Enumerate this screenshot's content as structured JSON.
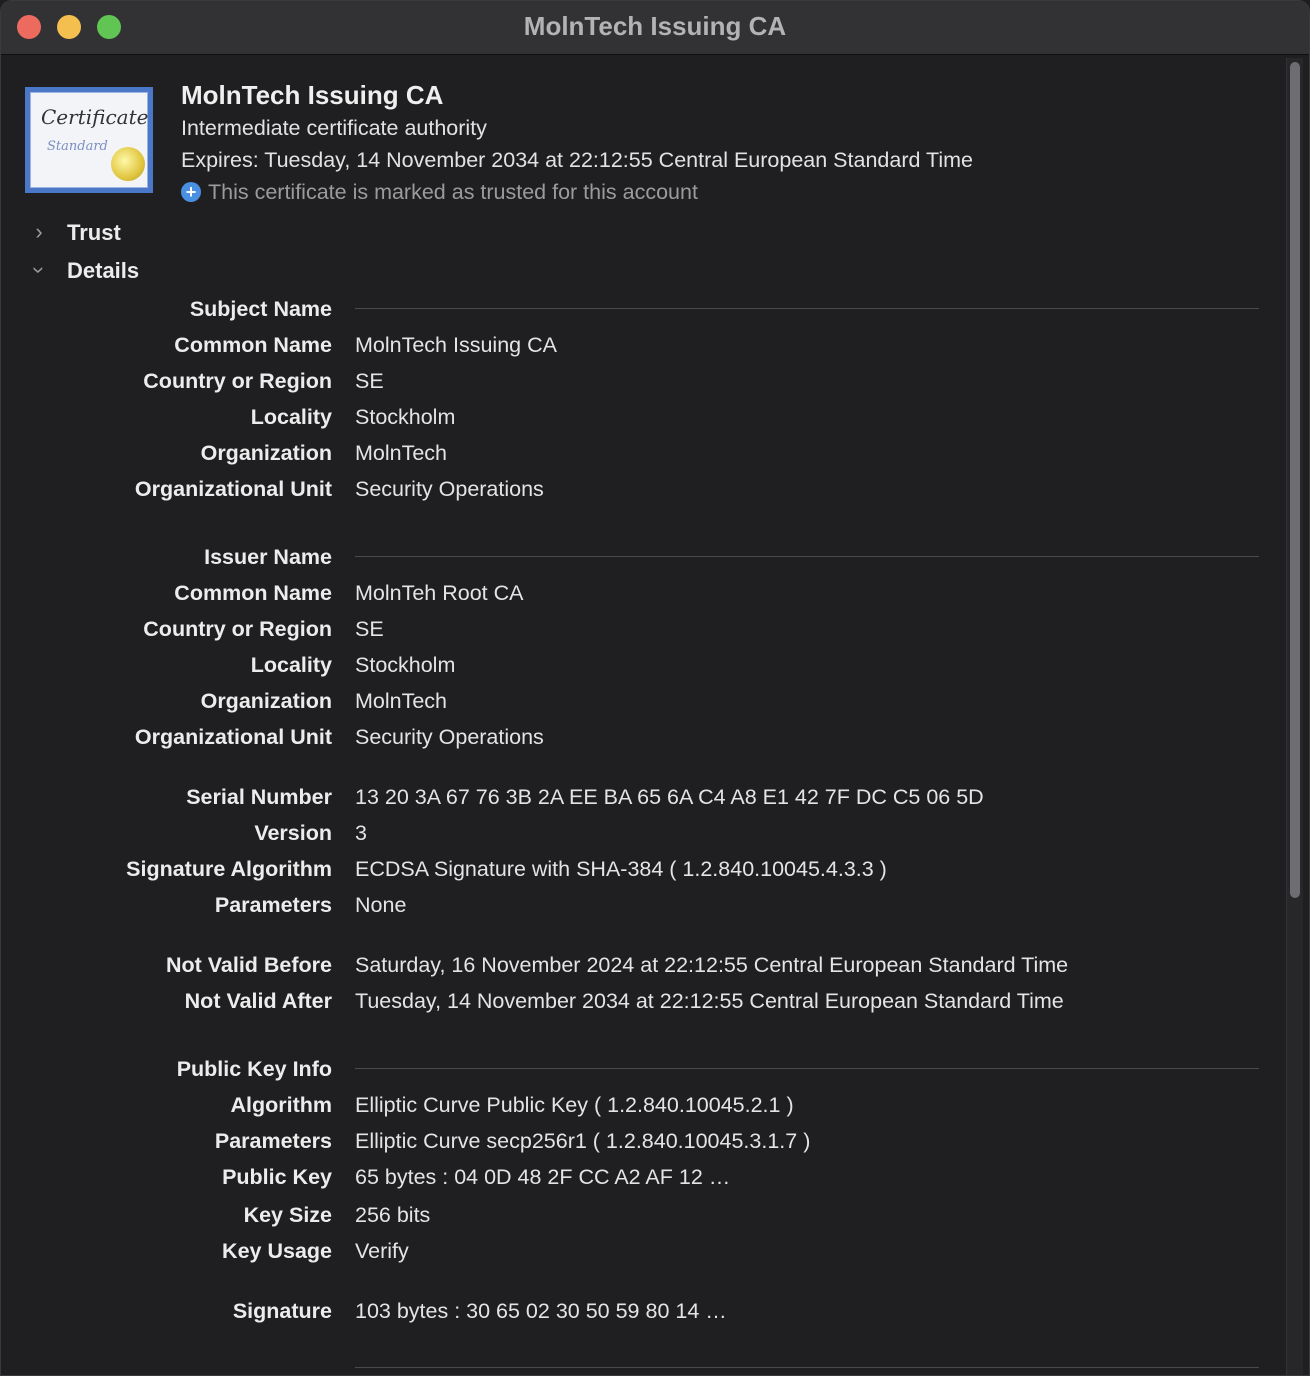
{
  "window": {
    "title": "MolnTech Issuing CA"
  },
  "cert_icon": {
    "script_top": "Certificate",
    "script_bottom": "Standard"
  },
  "header": {
    "name": "MolnTech Issuing CA",
    "kind": "Intermediate certificate authority",
    "expires": "Expires: Tuesday, 14 November 2034 at 22:12:55 Central European Standard Time",
    "trust_status": "This certificate is marked as trusted for this account"
  },
  "sections": {
    "trust": "Trust",
    "details": "Details"
  },
  "details": {
    "subject": {
      "heading": "Subject Name",
      "rows": [
        {
          "label": "Common Name",
          "value": "MolnTech Issuing CA"
        },
        {
          "label": "Country or Region",
          "value": "SE"
        },
        {
          "label": "Locality",
          "value": "Stockholm"
        },
        {
          "label": "Organization",
          "value": "MolnTech"
        },
        {
          "label": "Organizational Unit",
          "value": "Security Operations"
        }
      ]
    },
    "issuer": {
      "heading": "Issuer Name",
      "rows": [
        {
          "label": "Common Name",
          "value": "MolnTeh Root CA"
        },
        {
          "label": "Country or Region",
          "value": "SE"
        },
        {
          "label": "Locality",
          "value": "Stockholm"
        },
        {
          "label": "Organization",
          "value": "MolnTech"
        },
        {
          "label": "Organizational Unit",
          "value": "Security Operations"
        }
      ]
    },
    "general": {
      "rows": [
        {
          "label": "Serial Number",
          "value": "13 20 3A 67 76 3B 2A EE BA 65 6A C4 A8 E1 42 7F DC C5 06 5D"
        },
        {
          "label": "Version",
          "value": "3"
        },
        {
          "label": "Signature Algorithm",
          "value": "ECDSA Signature with SHA-384 ( 1.2.840.10045.4.3.3 )"
        },
        {
          "label": "Parameters",
          "value": "None"
        }
      ]
    },
    "validity": {
      "rows": [
        {
          "label": "Not Valid Before",
          "value": "Saturday, 16 November 2024 at 22:12:55 Central European Standard Time"
        },
        {
          "label": "Not Valid After",
          "value": "Tuesday, 14 November 2034 at 22:12:55 Central European Standard Time"
        }
      ]
    },
    "public_key": {
      "heading": "Public Key Info",
      "rows": [
        {
          "label": "Algorithm",
          "value": "Elliptic Curve Public Key ( 1.2.840.10045.2.1 )"
        },
        {
          "label": "Parameters",
          "value": "Elliptic Curve secp256r1 ( 1.2.840.10045.3.1.7 )"
        },
        {
          "label": "Public Key",
          "value": "65 bytes : 04 0D 48 2F CC A2 AF 12 …"
        },
        {
          "label": "Key Size",
          "value": "256 bits"
        },
        {
          "label": "Key Usage",
          "value": "Verify"
        }
      ]
    },
    "signature": {
      "rows": [
        {
          "label": "Signature",
          "value": "103 bytes : 30 65 02 30 50 59 80 14 …"
        }
      ]
    }
  }
}
